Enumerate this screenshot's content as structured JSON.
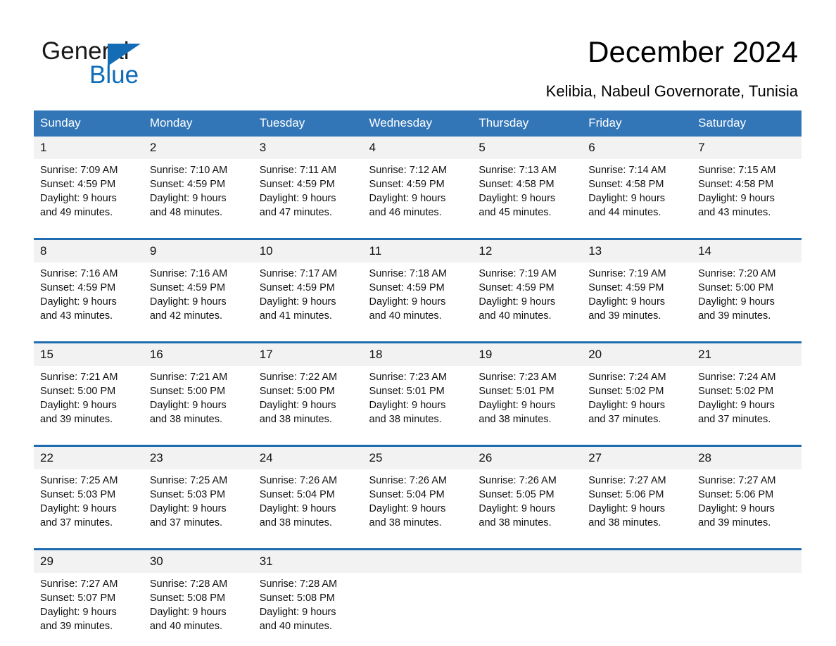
{
  "brand": {
    "line1": "General",
    "line2": "Blue",
    "triangle_color": "#146cb4",
    "text_color": "#1a1a1a",
    "blue_text_color": "#0d6cb8"
  },
  "header": {
    "title": "December 2024",
    "subtitle": "Kelibia, Nabeul Governorate, Tunisia"
  },
  "colors": {
    "header_background": "#3276b8",
    "header_text": "#ffffff",
    "week_separator": "#1f6cb0",
    "daynum_background": "#f2f2f2",
    "cell_background": "#ffffff"
  },
  "calendar": {
    "weekdays": [
      "Sunday",
      "Monday",
      "Tuesday",
      "Wednesday",
      "Thursday",
      "Friday",
      "Saturday"
    ],
    "weeks": [
      {
        "days": [
          {
            "num": "1",
            "detail": "Sunrise: 7:09 AM\nSunset: 4:59 PM\nDaylight: 9 hours\nand 49 minutes."
          },
          {
            "num": "2",
            "detail": "Sunrise: 7:10 AM\nSunset: 4:59 PM\nDaylight: 9 hours\nand 48 minutes."
          },
          {
            "num": "3",
            "detail": "Sunrise: 7:11 AM\nSunset: 4:59 PM\nDaylight: 9 hours\nand 47 minutes."
          },
          {
            "num": "4",
            "detail": "Sunrise: 7:12 AM\nSunset: 4:59 PM\nDaylight: 9 hours\nand 46 minutes."
          },
          {
            "num": "5",
            "detail": "Sunrise: 7:13 AM\nSunset: 4:58 PM\nDaylight: 9 hours\nand 45 minutes."
          },
          {
            "num": "6",
            "detail": "Sunrise: 7:14 AM\nSunset: 4:58 PM\nDaylight: 9 hours\nand 44 minutes."
          },
          {
            "num": "7",
            "detail": "Sunrise: 7:15 AM\nSunset: 4:58 PM\nDaylight: 9 hours\nand 43 minutes."
          }
        ]
      },
      {
        "days": [
          {
            "num": "8",
            "detail": "Sunrise: 7:16 AM\nSunset: 4:59 PM\nDaylight: 9 hours\nand 43 minutes."
          },
          {
            "num": "9",
            "detail": "Sunrise: 7:16 AM\nSunset: 4:59 PM\nDaylight: 9 hours\nand 42 minutes."
          },
          {
            "num": "10",
            "detail": "Sunrise: 7:17 AM\nSunset: 4:59 PM\nDaylight: 9 hours\nand 41 minutes."
          },
          {
            "num": "11",
            "detail": "Sunrise: 7:18 AM\nSunset: 4:59 PM\nDaylight: 9 hours\nand 40 minutes."
          },
          {
            "num": "12",
            "detail": "Sunrise: 7:19 AM\nSunset: 4:59 PM\nDaylight: 9 hours\nand 40 minutes."
          },
          {
            "num": "13",
            "detail": "Sunrise: 7:19 AM\nSunset: 4:59 PM\nDaylight: 9 hours\nand 39 minutes."
          },
          {
            "num": "14",
            "detail": "Sunrise: 7:20 AM\nSunset: 5:00 PM\nDaylight: 9 hours\nand 39 minutes."
          }
        ]
      },
      {
        "days": [
          {
            "num": "15",
            "detail": "Sunrise: 7:21 AM\nSunset: 5:00 PM\nDaylight: 9 hours\nand 39 minutes."
          },
          {
            "num": "16",
            "detail": "Sunrise: 7:21 AM\nSunset: 5:00 PM\nDaylight: 9 hours\nand 38 minutes."
          },
          {
            "num": "17",
            "detail": "Sunrise: 7:22 AM\nSunset: 5:00 PM\nDaylight: 9 hours\nand 38 minutes."
          },
          {
            "num": "18",
            "detail": "Sunrise: 7:23 AM\nSunset: 5:01 PM\nDaylight: 9 hours\nand 38 minutes."
          },
          {
            "num": "19",
            "detail": "Sunrise: 7:23 AM\nSunset: 5:01 PM\nDaylight: 9 hours\nand 38 minutes."
          },
          {
            "num": "20",
            "detail": "Sunrise: 7:24 AM\nSunset: 5:02 PM\nDaylight: 9 hours\nand 37 minutes."
          },
          {
            "num": "21",
            "detail": "Sunrise: 7:24 AM\nSunset: 5:02 PM\nDaylight: 9 hours\nand 37 minutes."
          }
        ]
      },
      {
        "days": [
          {
            "num": "22",
            "detail": "Sunrise: 7:25 AM\nSunset: 5:03 PM\nDaylight: 9 hours\nand 37 minutes."
          },
          {
            "num": "23",
            "detail": "Sunrise: 7:25 AM\nSunset: 5:03 PM\nDaylight: 9 hours\nand 37 minutes."
          },
          {
            "num": "24",
            "detail": "Sunrise: 7:26 AM\nSunset: 5:04 PM\nDaylight: 9 hours\nand 38 minutes."
          },
          {
            "num": "25",
            "detail": "Sunrise: 7:26 AM\nSunset: 5:04 PM\nDaylight: 9 hours\nand 38 minutes."
          },
          {
            "num": "26",
            "detail": "Sunrise: 7:26 AM\nSunset: 5:05 PM\nDaylight: 9 hours\nand 38 minutes."
          },
          {
            "num": "27",
            "detail": "Sunrise: 7:27 AM\nSunset: 5:06 PM\nDaylight: 9 hours\nand 38 minutes."
          },
          {
            "num": "28",
            "detail": "Sunrise: 7:27 AM\nSunset: 5:06 PM\nDaylight: 9 hours\nand 39 minutes."
          }
        ]
      },
      {
        "days": [
          {
            "num": "29",
            "detail": "Sunrise: 7:27 AM\nSunset: 5:07 PM\nDaylight: 9 hours\nand 39 minutes."
          },
          {
            "num": "30",
            "detail": "Sunrise: 7:28 AM\nSunset: 5:08 PM\nDaylight: 9 hours\nand 40 minutes."
          },
          {
            "num": "31",
            "detail": "Sunrise: 7:28 AM\nSunset: 5:08 PM\nDaylight: 9 hours\nand 40 minutes."
          },
          {
            "num": "",
            "detail": ""
          },
          {
            "num": "",
            "detail": ""
          },
          {
            "num": "",
            "detail": ""
          },
          {
            "num": "",
            "detail": ""
          }
        ]
      }
    ]
  }
}
